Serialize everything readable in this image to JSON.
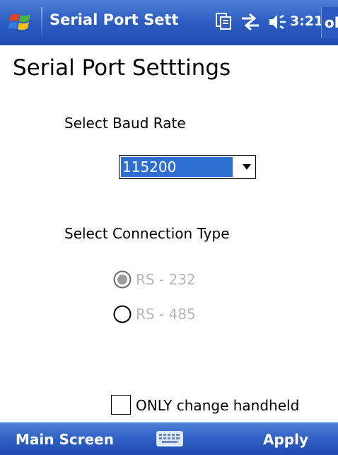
{
  "titlebar": {
    "app_title": "Serial Port Sett",
    "time": "3:21",
    "ok_label": "ok",
    "icons": [
      "windows-start-icon",
      "cards-icon",
      "connectivity-icon",
      "speaker-icon"
    ]
  },
  "page": {
    "title": "Serial Port Setttings"
  },
  "baud": {
    "label": "Select Baud Rate",
    "selected": "115200"
  },
  "connection": {
    "label": "Select Connection Type",
    "options": [
      {
        "label": "RS - 232",
        "selected": true,
        "enabled": false
      },
      {
        "label": "RS - 485",
        "selected": false,
        "enabled": false
      }
    ]
  },
  "handheld": {
    "label": "ONLY change handheld",
    "checked": false
  },
  "menubar": {
    "left_label": "Main Screen",
    "right_label": "Apply",
    "center_icon": "keyboard-icon"
  },
  "colors": {
    "titlebar": "#2f5fc3",
    "selection": "#2f6fd1",
    "disabled_text": "#b8b8b8"
  }
}
